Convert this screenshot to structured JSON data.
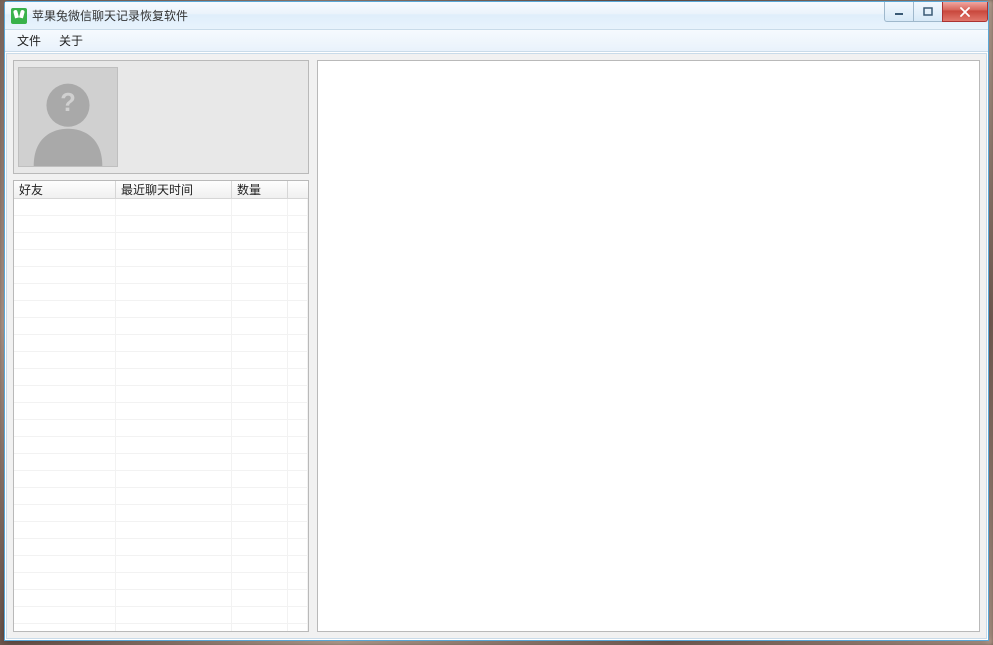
{
  "window": {
    "title": "苹果兔微信聊天记录恢复软件"
  },
  "menubar": {
    "items": [
      {
        "label": "文件"
      },
      {
        "label": "关于"
      }
    ]
  },
  "table": {
    "headers": {
      "friend": "好友",
      "last_chat_time": "最近聊天时间",
      "count": "数量"
    },
    "rows": []
  }
}
